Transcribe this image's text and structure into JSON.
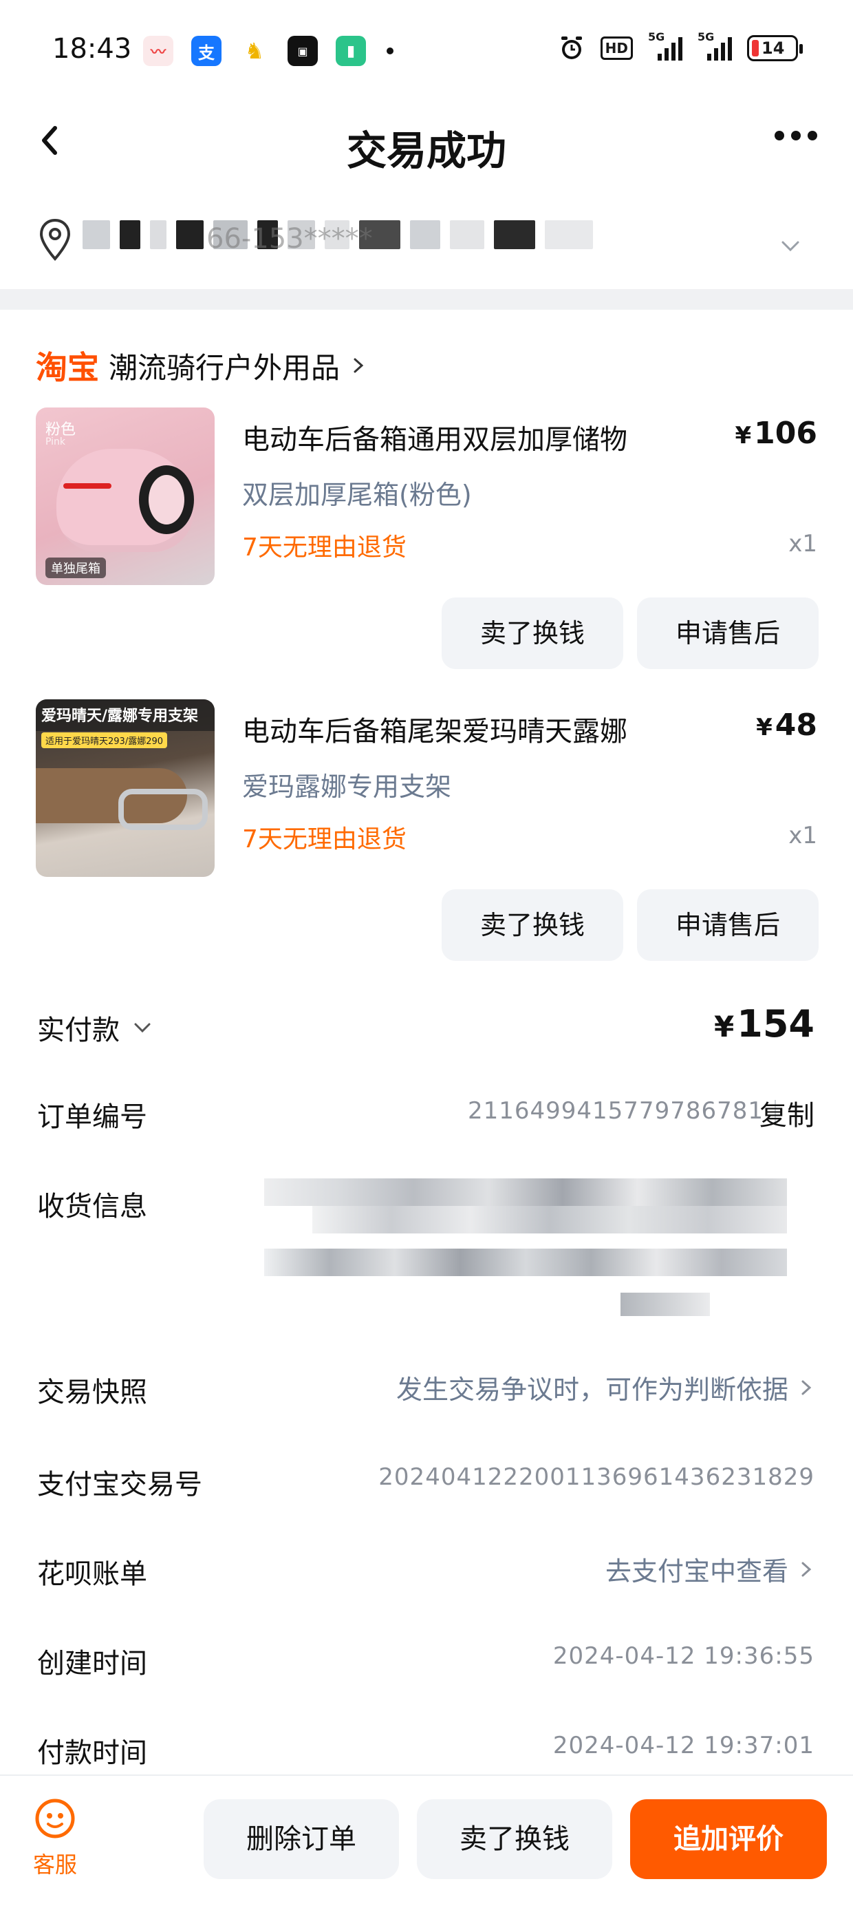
{
  "status_bar": {
    "time": "18:43",
    "app_icons": [
      "voice-icon",
      "alipay-icon",
      "mascot-icon",
      "app-icon",
      "battery-app-icon"
    ],
    "hd_label": "HD",
    "network_1": "5G",
    "network_2": "5G",
    "battery": "14"
  },
  "nav": {
    "title": "交易成功"
  },
  "address": {
    "text": "66-153*****"
  },
  "shop": {
    "logo": "淘宝",
    "name": "潮流骑行户外用品"
  },
  "items": [
    {
      "thumb_tag": "粉色",
      "thumb_tag_sub": "Pink",
      "thumb_badge": "单独尾箱",
      "title": "电动车后备箱通用双层加厚储物",
      "price": "106",
      "sku": "双层加厚尾箱(粉色)",
      "return_policy": "7天无理由退货",
      "qty": "x1",
      "sell_label": "卖了换钱",
      "after_sale_label": "申请售后"
    },
    {
      "thumb_tag": "爱玛晴天/露娜专用支架",
      "thumb_badge": "适用于爱玛晴天293/露娜290",
      "title": "电动车后备箱尾架爱玛晴天露娜",
      "price": "48",
      "sku": "爱玛露娜专用支架",
      "return_policy": "7天无理由退货",
      "qty": "x1",
      "sell_label": "卖了换钱",
      "after_sale_label": "申请售后"
    }
  ],
  "currency": "¥",
  "payment": {
    "label": "实付款",
    "amount": "154"
  },
  "order": {
    "label": "订单编号",
    "number": "2116499415779786781",
    "copy_label": "复制"
  },
  "receiver": {
    "label": "收货信息"
  },
  "snapshot": {
    "label": "交易快照",
    "link": "发生交易争议时，可作为判断依据"
  },
  "alipay_trade": {
    "label": "支付宝交易号",
    "number": "2024041222001136961436231829"
  },
  "huabei": {
    "label": "花呗账单",
    "link": "去支付宝中查看"
  },
  "created": {
    "label": "创建时间",
    "value": "2024-04-12 19:36:55"
  },
  "paid": {
    "label": "付款时间",
    "value": "2024-04-12 19:37:01"
  },
  "bottom_bar": {
    "service_label": "客服",
    "delete_label": "删除订单",
    "sell_label": "卖了换钱",
    "review_label": "追加评价"
  },
  "colors": {
    "accent": "#ff5a00",
    "link_gray": "#6b7a90",
    "value_gray": "#8a8f98",
    "button_bg": "#f2f4f7"
  }
}
